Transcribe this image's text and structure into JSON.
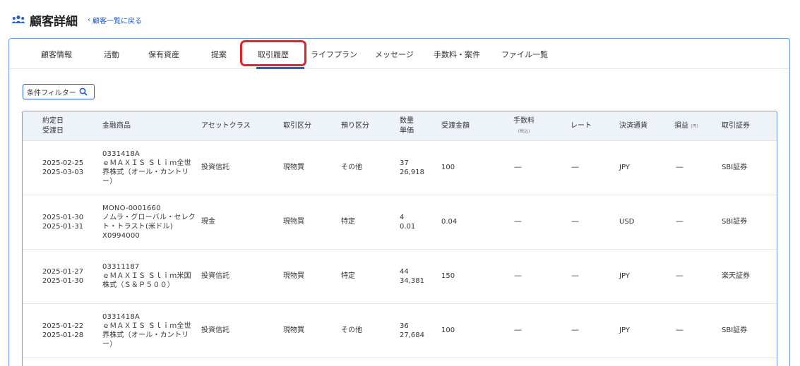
{
  "header": {
    "title": "顧客詳細",
    "back_link": "顧客一覧に戻る"
  },
  "tabs": [
    {
      "label": "顧客情報"
    },
    {
      "label": "活動"
    },
    {
      "label": "保有資産"
    },
    {
      "label": "提案"
    },
    {
      "label": "取引履歴",
      "active": true
    },
    {
      "label": "ライフプラン"
    },
    {
      "label": "メッセージ"
    },
    {
      "label": "手数料・案件"
    },
    {
      "label": "ファイル一覧"
    }
  ],
  "filter": {
    "label": "条件フィルター"
  },
  "table": {
    "headers": {
      "date_contract": "約定日",
      "date_settle": "受渡日",
      "product": "金融商品",
      "asset_class": "アセットクラス",
      "trade_type": "取引区分",
      "custody": "預り区分",
      "qty": "数量",
      "unit_price": "単価",
      "amount": "受渡金額",
      "fee": "手数料",
      "fee_note": "(税込)",
      "rate": "レート",
      "currency": "決済通貨",
      "pl": "損益",
      "pl_note": "(円)",
      "broker": "取引証券"
    },
    "rows": [
      {
        "contract": "2025-02-25",
        "settle": "2025-03-03",
        "code": "0331418A",
        "product_name": "ｅＭＡＸＩＳ Ｓｌｉｍ全世界株式（オール・カントリー）",
        "asset_class": "投資信託",
        "trade_type": "現物買",
        "custody": "その他",
        "qty": "37",
        "unit_price": "26,918",
        "amount": "100",
        "fee": "—",
        "rate": "—",
        "currency": "JPY",
        "pl": "—",
        "broker": "SBI証券"
      },
      {
        "contract": "2025-01-30",
        "settle": "2025-01-31",
        "code": "MONO-0001660",
        "product_name": "ノムラ・グローバル・セレクト・トラスト(米ドル) X0994000",
        "asset_class": "現金",
        "trade_type": "現物買",
        "custody": "特定",
        "qty": "4",
        "unit_price": "0.01",
        "amount": "0.04",
        "fee": "—",
        "rate": "—",
        "currency": "USD",
        "pl": "—",
        "broker": "SBI証券"
      },
      {
        "contract": "2025-01-27",
        "settle": "2025-01-30",
        "code": "03311187",
        "product_name": "ｅＭＡＸＩＳ Ｓｌｉｍ米国株式（Ｓ＆Ｐ５００）",
        "asset_class": "投資信託",
        "trade_type": "現物買",
        "custody": "特定",
        "qty": "44",
        "unit_price": "34,381",
        "amount": "150",
        "fee": "—",
        "rate": "—",
        "currency": "JPY",
        "pl": "—",
        "broker": "楽天証券"
      },
      {
        "contract": "2025-01-22",
        "settle": "2025-01-28",
        "code": "0331418A",
        "product_name": "ｅＭＡＸＩＳ Ｓｌｉｍ全世界株式（オール・カントリー）",
        "asset_class": "投資信託",
        "trade_type": "現物買",
        "custody": "その他",
        "qty": "36",
        "unit_price": "27,684",
        "amount": "100",
        "fee": "—",
        "rate": "—",
        "currency": "JPY",
        "pl": "—",
        "broker": "SBI証券"
      }
    ]
  }
}
